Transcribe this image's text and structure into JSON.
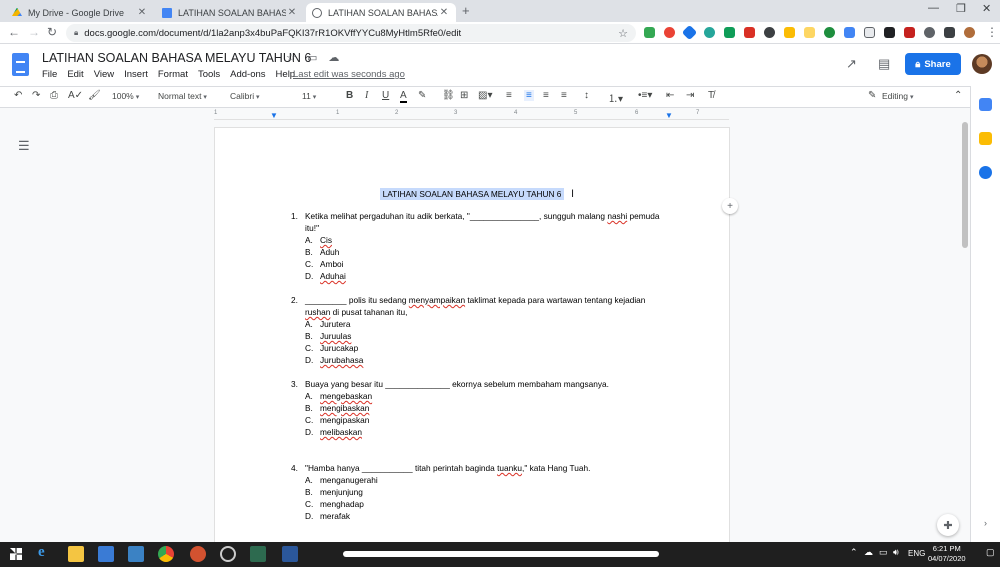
{
  "browser": {
    "tabs": [
      {
        "label": "My Drive - Google Drive",
        "close": "✕",
        "icon": "drive-icon"
      },
      {
        "label": "LATIHAN SOALAN BAHASA MELA",
        "close": "✕",
        "icon": "docs-icon"
      },
      {
        "label": "LATIHAN SOALAN BAHASA MELA",
        "close": "✕",
        "icon": "docs-icon"
      }
    ],
    "new_tab": "+",
    "url": "docs.google.com/document/d/1la2anp3x4buPaFQKI37rR1OKVffYYCu8MyHtlm5Rfe0/edit"
  },
  "docs": {
    "title": "LATIHAN SOALAN BAHASA MELAYU TAHUN 6",
    "menu": [
      "File",
      "Edit",
      "View",
      "Insert",
      "Format",
      "Tools",
      "Add-ons",
      "Help"
    ],
    "last_edit": "Last edit was seconds ago",
    "share_label": "Share",
    "accent": "#1a73e8"
  },
  "toolbar": {
    "zoom": "100%",
    "style": "Normal text",
    "font": "Calibri",
    "size": "11",
    "mode": "Editing"
  },
  "ruler": [
    "1",
    "1",
    "2",
    "3",
    "4",
    "5",
    "6",
    "7"
  ],
  "document": {
    "heading": "LATIHAN SOALAN BAHASA MELAYU TAHUN 6",
    "questions": [
      {
        "num": "1.",
        "stem_a": "Ketika melihat pergaduhan itu adik berkata, \"_______________, sungguh malang ",
        "stem_b": "nashi",
        "stem_c": " pemuda itu!\"",
        "options": [
          {
            "letter": "A.",
            "text": "Cis"
          },
          {
            "letter": "B.",
            "text": "Aduh"
          },
          {
            "letter": "C.",
            "text": "Amboi"
          },
          {
            "letter": "D.",
            "text": "Aduhai"
          }
        ]
      },
      {
        "num": "2.",
        "stem_a": "_________ polis itu sedang ",
        "stem_b": "menyampaikan",
        "stem_c": " taklimat kepada para wartawan tentang kejadian ",
        "stem_d": "rushan",
        "stem_e": " di pusat tahanan itu,",
        "options": [
          {
            "letter": "A.",
            "text": "Jurutera"
          },
          {
            "letter": "B.",
            "text": "Juruulas"
          },
          {
            "letter": "C.",
            "text": "Jurucakap"
          },
          {
            "letter": "D.",
            "text": "Jurubahasa"
          }
        ]
      },
      {
        "num": "3.",
        "stem_a": "Buaya yang besar itu ______________ ekornya sebelum membaham mangsanya.",
        "options": [
          {
            "letter": "A.",
            "text": "mengebaskan"
          },
          {
            "letter": "B.",
            "text": "mengibaskan"
          },
          {
            "letter": "C.",
            "text": "mengipaskan"
          },
          {
            "letter": "D.",
            "text": "melibaskan"
          }
        ]
      },
      {
        "num": "4.",
        "stem_a": "\"Hamba hanya ___________ titah perintah baginda ",
        "stem_b": "tuanku",
        "stem_c": ",\" kata Hang Tuah.",
        "options": [
          {
            "letter": "A.",
            "text": "menganugerahi"
          },
          {
            "letter": "B.",
            "text": "menjunjung"
          },
          {
            "letter": "C.",
            "text": "menghadap"
          },
          {
            "letter": "D.",
            "text": "merafak"
          }
        ]
      }
    ]
  },
  "taskbar": {
    "lang": "ENG",
    "time": "6:21 PM",
    "date": "04/07/2020"
  }
}
